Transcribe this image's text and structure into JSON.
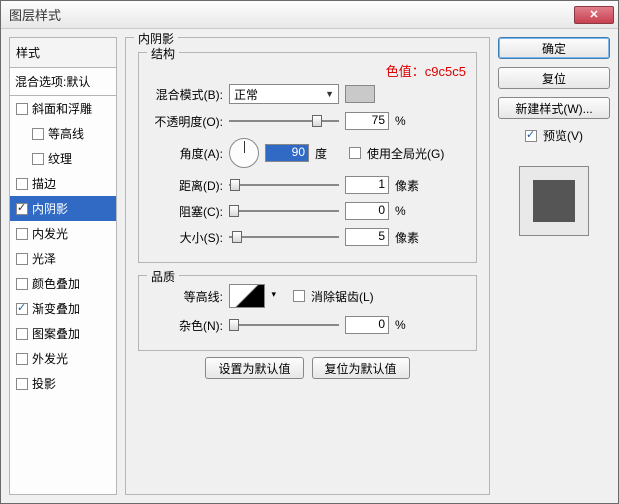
{
  "title": "图层样式",
  "styles_panel": {
    "header": "样式",
    "blend_options": "混合选项:默认",
    "items": [
      {
        "label": "斜面和浮雕",
        "checked": false,
        "indent": false
      },
      {
        "label": "等高线",
        "checked": false,
        "indent": true
      },
      {
        "label": "纹理",
        "checked": false,
        "indent": true
      },
      {
        "label": "描边",
        "checked": false,
        "indent": false
      },
      {
        "label": "内阴影",
        "checked": true,
        "indent": false,
        "selected": true
      },
      {
        "label": "内发光",
        "checked": false,
        "indent": false
      },
      {
        "label": "光泽",
        "checked": false,
        "indent": false
      },
      {
        "label": "颜色叠加",
        "checked": false,
        "indent": false
      },
      {
        "label": "渐变叠加",
        "checked": true,
        "indent": false
      },
      {
        "label": "图案叠加",
        "checked": false,
        "indent": false
      },
      {
        "label": "外发光",
        "checked": false,
        "indent": false
      },
      {
        "label": "投影",
        "checked": false,
        "indent": false
      }
    ]
  },
  "main": {
    "section_title": "内阴影",
    "structure_title": "结构",
    "annotation": "色值：c9c5c5",
    "blend_mode_label": "混合模式(B):",
    "blend_mode_value": "正常",
    "swatch_color": "#c9c5c5",
    "opacity_label": "不透明度(O):",
    "opacity_value": "75",
    "percent": "%",
    "angle_label": "角度(A):",
    "angle_value": "90",
    "angle_unit": "度",
    "global_light_label": "使用全局光(G)",
    "global_light_checked": false,
    "distance_label": "距离(D):",
    "distance_value": "1",
    "px_unit": "像素",
    "choke_label": "阻塞(C):",
    "choke_value": "0",
    "size_label": "大小(S):",
    "size_value": "5",
    "quality_title": "品质",
    "contour_label": "等高线:",
    "anti_alias_label": "消除锯齿(L)",
    "anti_alias_checked": false,
    "noise_label": "杂色(N):",
    "noise_value": "0",
    "set_default": "设置为默认值",
    "reset_default": "复位为默认值"
  },
  "rpanel": {
    "ok": "确定",
    "reset": "复位",
    "new_style": "新建样式(W)...",
    "preview_label": "预览(V)",
    "preview_checked": true
  }
}
